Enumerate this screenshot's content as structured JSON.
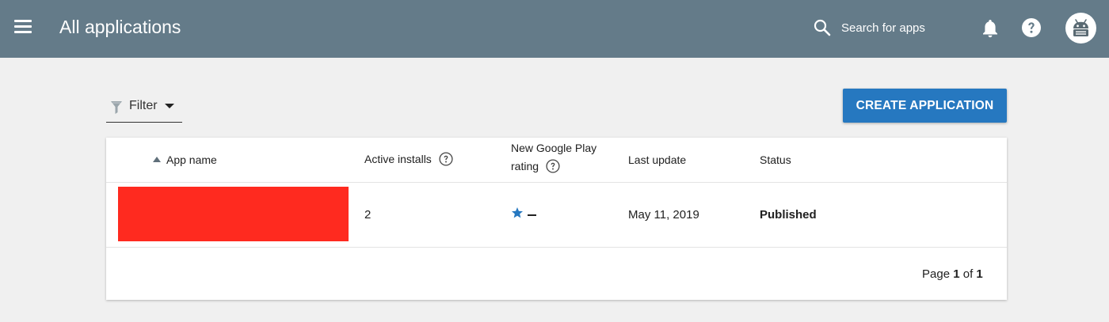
{
  "header": {
    "title": "All applications",
    "search_placeholder": "Search for apps"
  },
  "toolbar": {
    "filter_label": "Filter",
    "create_label": "CREATE APPLICATION"
  },
  "table": {
    "columns": {
      "app_name": "App name",
      "active_installs": "Active installs",
      "rating_line1": "New Google Play",
      "rating_line2": "rating",
      "last_update": "Last update",
      "status": "Status"
    },
    "rows": [
      {
        "app_name": "",
        "active_installs": "2",
        "rating": "—",
        "last_update": "May 11, 2019",
        "status": "Published"
      }
    ],
    "pagination": {
      "prefix": "Page",
      "current": "1",
      "separator": "of",
      "total": "1"
    }
  },
  "colors": {
    "topbar": "#647b89",
    "primary_button": "#2678c0",
    "star": "#2678c0",
    "redaction": "#ff2a1f",
    "background": "#f0f0f0"
  },
  "icons": {
    "menu": "menu-icon",
    "search": "search-icon",
    "notifications": "bell-icon",
    "help": "help-icon",
    "account": "android-avatar-icon",
    "filter": "funnel-icon",
    "sort": "sort-ascending-icon",
    "info": "question-circle-icon",
    "rating": "star-icon"
  }
}
